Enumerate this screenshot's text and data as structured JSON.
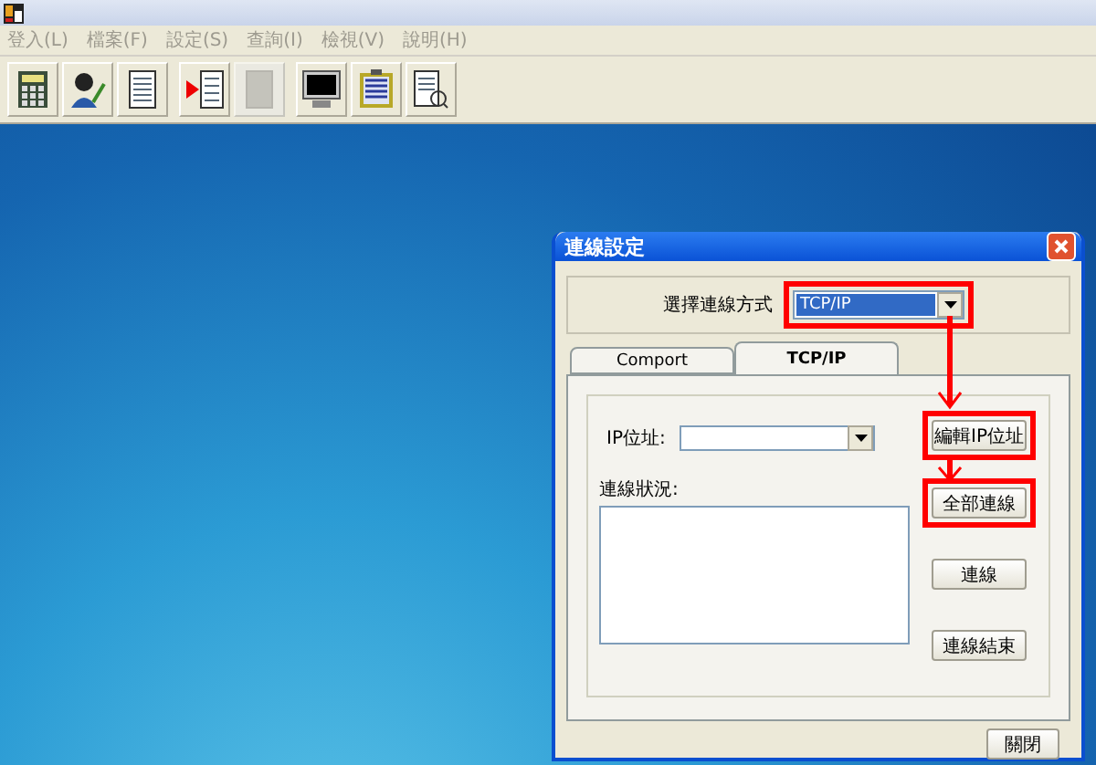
{
  "menu": [
    {
      "label": "登入(L)",
      "disabled": true
    },
    {
      "label": "檔案(F)",
      "disabled": true
    },
    {
      "label": "設定(S)",
      "disabled": true
    },
    {
      "label": "查詢(I)",
      "disabled": true
    },
    {
      "label": "檢視(V)",
      "disabled": true
    },
    {
      "label": "說明(H)",
      "disabled": true
    }
  ],
  "toolbar": [
    [
      {
        "kind": "calculator",
        "disabled": false
      },
      {
        "kind": "person",
        "disabled": false
      },
      {
        "kind": "document",
        "disabled": false
      }
    ],
    [
      {
        "kind": "play-document",
        "disabled": false
      },
      {
        "kind": "document",
        "disabled": true
      }
    ],
    [
      {
        "kind": "monitor",
        "disabled": false
      },
      {
        "kind": "clipboard",
        "disabled": false
      },
      {
        "kind": "search-document",
        "disabled": false
      }
    ]
  ],
  "dialog": {
    "title": "連線設定",
    "method": {
      "label": "選擇連線方式",
      "value": "TCP/IP",
      "highlighted": true
    },
    "tabs": [
      {
        "label": "Comport",
        "selected": false
      },
      {
        "label": "TCP/IP",
        "selected": true
      }
    ],
    "ip": {
      "label": "IP位址:"
    },
    "status": {
      "label": "連線狀況:"
    },
    "buttons": [
      {
        "label": "編輯IP位址",
        "highlighted": true
      },
      {
        "label": "全部連線",
        "highlighted": true
      },
      {
        "label": "連線",
        "highlighted": false
      },
      {
        "label": "連線結束",
        "highlighted": false
      }
    ],
    "close_button": "關閉"
  }
}
